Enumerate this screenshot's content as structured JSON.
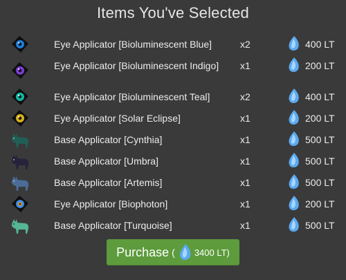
{
  "header": {
    "title": "Items You've Selected"
  },
  "items": [
    {
      "name": "Eye Applicator [Bioluminescent Blue]",
      "qty": "x2",
      "price": "400 LT",
      "icon": "eye-applicator-icon",
      "color": "#1e7fd6"
    },
    {
      "name": "Eye Applicator [Bioluminescent Indigo]",
      "qty": "x1",
      "price": "200 LT",
      "icon": "eye-applicator-icon",
      "color": "#7b3fd0"
    },
    {
      "name": "Eye Applicator [Bioluminescent Teal]",
      "qty": "x2",
      "price": "400 LT",
      "icon": "eye-applicator-icon",
      "color": "#17b8a3"
    },
    {
      "name": "Eye Applicator [Solar Eclipse]",
      "qty": "x1",
      "price": "200 LT",
      "icon": "eye-applicator-icon",
      "color": "#d8b21a"
    },
    {
      "name": "Base Applicator [Cynthia]",
      "qty": "x1",
      "price": "500 LT",
      "icon": "wolf-base-icon",
      "color": "#1f5f55"
    },
    {
      "name": "Base Applicator [Umbra]",
      "qty": "x1",
      "price": "500 LT",
      "icon": "wolf-base-icon",
      "color": "#26223a"
    },
    {
      "name": "Base Applicator [Artemis]",
      "qty": "x1",
      "price": "500 LT",
      "icon": "wolf-base-icon",
      "color": "#4a6c96"
    },
    {
      "name": "Eye Applicator [Biophoton]",
      "qty": "x1",
      "price": "200 LT",
      "icon": "eye-applicator-icon",
      "color": "#3a8be0"
    },
    {
      "name": "Base Applicator [Turquoise]",
      "qty": "x1",
      "price": "500 LT",
      "icon": "wolf-base-icon",
      "color": "#55b594"
    }
  ],
  "currency": {
    "icon": "lunar-tear-gem-icon",
    "color": "#5aaaf0"
  },
  "purchase": {
    "label": "Purchase",
    "open_paren": "(",
    "total": "3400 LT)",
    "color": "#5d9b3c"
  }
}
